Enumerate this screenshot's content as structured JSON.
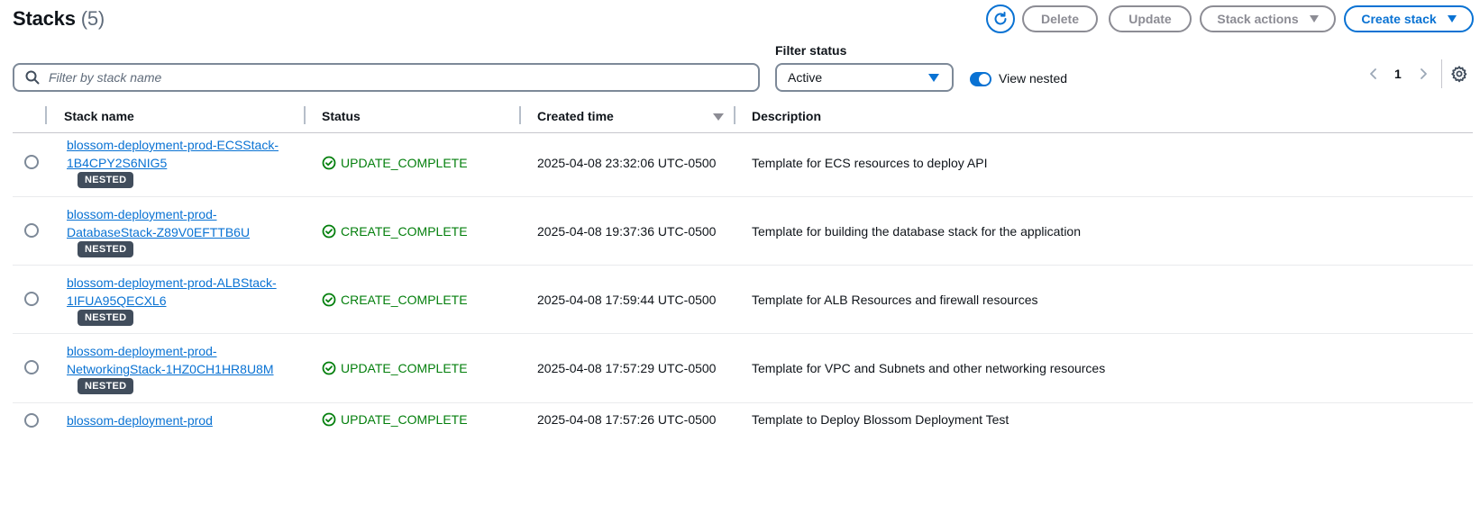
{
  "header": {
    "title": "Stacks",
    "count": "(5)",
    "buttons": {
      "delete": "Delete",
      "update": "Update",
      "stack_actions": "Stack actions",
      "create_stack": "Create stack"
    }
  },
  "filters": {
    "search_placeholder": "Filter by stack name",
    "status_label": "Filter status",
    "status_value": "Active",
    "view_nested_label": "View nested",
    "view_nested_on": true
  },
  "pagination": {
    "current_page": "1"
  },
  "table": {
    "columns": [
      "Stack name",
      "Status",
      "Created time",
      "Description"
    ],
    "rows": [
      {
        "name_line1": "blossom-deployment-prod-ECSStack-",
        "name_line2": "1B4CPY2S6NIG5",
        "badge": "NESTED",
        "status": "UPDATE_COMPLETE",
        "created": "2025-04-08 23:32:06 UTC-0500",
        "description": "Template for ECS resources to deploy API"
      },
      {
        "name_line1": "blossom-deployment-prod-",
        "name_line2": "DatabaseStack-Z89V0EFTTB6U",
        "badge": "NESTED",
        "status": "CREATE_COMPLETE",
        "created": "2025-04-08 19:37:36 UTC-0500",
        "description": "Template for building the database stack for the application"
      },
      {
        "name_line1": "blossom-deployment-prod-ALBStack-",
        "name_line2": "1IFUA95QECXL6",
        "badge": "NESTED",
        "status": "CREATE_COMPLETE",
        "created": "2025-04-08 17:59:44 UTC-0500",
        "description": "Template for ALB Resources and firewall resources"
      },
      {
        "name_line1": "blossom-deployment-prod-",
        "name_line2": "NetworkingStack-1HZ0CH1HR8U8M",
        "badge": "NESTED",
        "status": "UPDATE_COMPLETE",
        "created": "2025-04-08 17:57:29 UTC-0500",
        "description": "Template for VPC and Subnets and other networking resources"
      },
      {
        "name_line1": "blossom-deployment-prod",
        "name_line2": "",
        "badge": "",
        "status": "UPDATE_COMPLETE",
        "created": "2025-04-08 17:57:26 UTC-0500",
        "description": "Template to Deploy Blossom Deployment Test"
      }
    ]
  },
  "colors": {
    "accent": "#0972d3",
    "success": "#037f0c",
    "badge_bg": "#414d5c"
  }
}
